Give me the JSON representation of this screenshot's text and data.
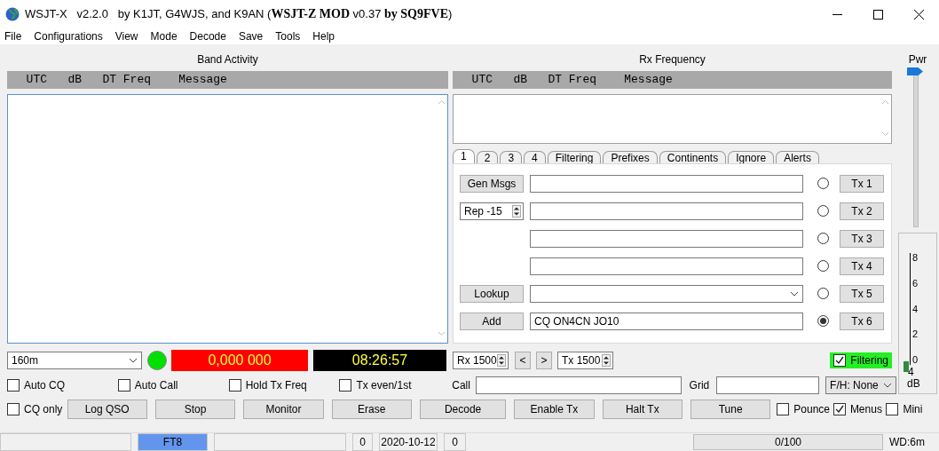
{
  "window": {
    "title": "WSJT-X   v2.2.0   by K1JT, G4WJS, and K9AN (**WSJT-Z MOD** v0.37 **by SQ9FVE**)"
  },
  "menu": [
    "File",
    "Configurations",
    "View",
    "Mode",
    "Decode",
    "Save",
    "Tools",
    "Help"
  ],
  "band_activity": {
    "title": "Band Activity",
    "header": "  UTC   dB   DT Freq    Message"
  },
  "rx_frequency": {
    "title": "Rx Frequency",
    "header": "  UTC   dB   DT Freq    Message"
  },
  "tabs": [
    {
      "label": "1",
      "selected": true
    },
    {
      "label": "2",
      "selected": false
    },
    {
      "label": "3",
      "selected": false
    },
    {
      "label": "4",
      "selected": false
    },
    {
      "label": "Filtering",
      "selected": false
    },
    {
      "label": "Prefixes",
      "selected": false
    },
    {
      "label": "Continents",
      "selected": false
    },
    {
      "label": "Ignore",
      "selected": false
    },
    {
      "label": "Alerts",
      "selected": false
    }
  ],
  "tx_rows": [
    {
      "kind": "button",
      "control": "Gen Msgs",
      "dropdown": false,
      "selected": false,
      "tx": "Tx 1"
    },
    {
      "kind": "spinbox",
      "control": "Rep -15",
      "dropdown": false,
      "selected": false,
      "tx": "Tx 2"
    },
    {
      "kind": "none",
      "dropdown": false,
      "selected": false,
      "tx": "Tx 3"
    },
    {
      "kind": "none",
      "dropdown": false,
      "selected": false,
      "tx": "Tx 4"
    },
    {
      "kind": "button",
      "control": "Lookup",
      "dropdown": true,
      "selected": false,
      "tx": "Tx 5"
    },
    {
      "kind": "button",
      "control": "Add",
      "message": "CQ ON4CN JO10",
      "dropdown": false,
      "selected": true,
      "tx": "Tx 6"
    }
  ],
  "band": "160m",
  "monitor_on": true,
  "frequency": "0,000 000",
  "clock": "08:26:57",
  "rx_spin": "Rx 1500",
  "prev": "<",
  "next": ">",
  "tx_spin": "Tx 1500",
  "filtering": {
    "label": "Filtering",
    "checked": true
  },
  "options": [
    {
      "label": "Auto CQ",
      "checked": false
    },
    {
      "label": "Auto Call",
      "checked": false
    },
    {
      "label": "Hold Tx Freq",
      "checked": false
    },
    {
      "label": "Tx even/1st",
      "checked": false
    }
  ],
  "call": {
    "label": "Call"
  },
  "grid": {
    "label": "Grid"
  },
  "fh": "F/H: None",
  "cq_only": {
    "label": "CQ only",
    "checked": false
  },
  "buttons": [
    "Log QSO",
    "Stop",
    "Monitor",
    "Erase",
    "Decode",
    "Enable Tx",
    "Halt Tx",
    "Tune"
  ],
  "toggles": [
    {
      "label": "Pounce",
      "checked": false
    },
    {
      "label": "Menus",
      "checked": true
    },
    {
      "label": "Mini",
      "checked": false
    }
  ],
  "power": {
    "label": "Pwr",
    "level": 1
  },
  "meter": {
    "scale": [
      "8",
      "6",
      "4",
      "2",
      "0"
    ],
    "level": 0.03,
    "reading": "4",
    "unit": "dB"
  },
  "status_bar": {
    "mode": "FT8",
    "count_1": "0",
    "date": "2020-10-12",
    "count_2": "0",
    "progress": {
      "text": "0/100",
      "level": 0
    },
    "watchdog": "WD:6m"
  }
}
